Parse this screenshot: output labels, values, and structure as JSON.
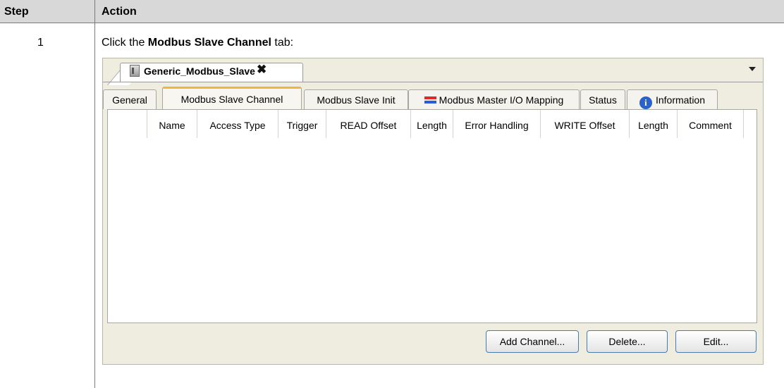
{
  "table": {
    "header_step": "Step",
    "header_action": "Action",
    "rows": [
      {
        "step": "1",
        "instruction_prefix": "Click the ",
        "instruction_bold": "Modbus Slave Channel",
        "instruction_suffix": " tab:"
      }
    ]
  },
  "editor": {
    "tab_label": "Generic_Modbus_Slave",
    "close_glyph": "✖",
    "subtabs": [
      {
        "label": "General",
        "active": false
      },
      {
        "label": "Modbus Slave Channel",
        "active": true
      },
      {
        "label": "Modbus Slave Init",
        "active": false
      },
      {
        "label": "Modbus Master I/O Mapping",
        "active": false,
        "icon": "transfer-arrows-icon"
      },
      {
        "label": "Status",
        "active": false
      },
      {
        "label": "Information",
        "active": false,
        "icon": "info-icon"
      }
    ],
    "info_glyph": "i",
    "columns": [
      "Name",
      "Access Type",
      "Trigger",
      "READ Offset",
      "Length",
      "Error Handling",
      "WRITE Offset",
      "Length",
      "Comment"
    ],
    "buttons": {
      "add_channel": "Add Channel...",
      "delete": "Delete...",
      "edit": "Edit..."
    },
    "colors": {
      "panel_bg": "#efeddf",
      "active_tab_accent": "#f2b43a",
      "button_border": "#4a7bb0"
    }
  }
}
